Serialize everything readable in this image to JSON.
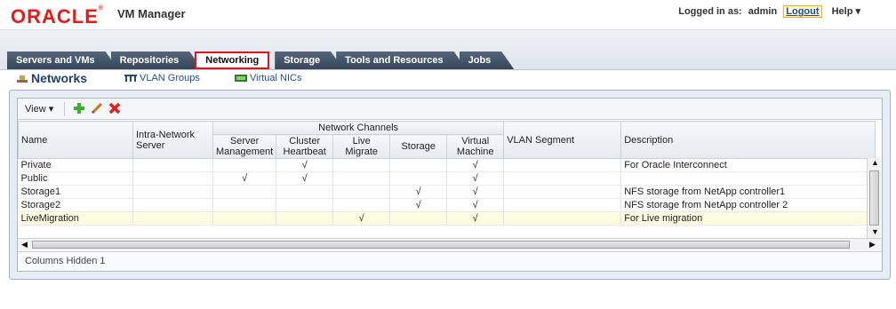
{
  "brand": {
    "logo": "ORACLE",
    "app_title": "VM Manager"
  },
  "header": {
    "logged_in_label": "Logged in as:",
    "user": "admin",
    "logout": "Logout",
    "help": "Help"
  },
  "tabs": [
    {
      "label": "Servers and VMs",
      "active": false
    },
    {
      "label": "Repositories",
      "active": false
    },
    {
      "label": "Networking",
      "active": true
    },
    {
      "label": "Storage",
      "active": false
    },
    {
      "label": "Tools and Resources",
      "active": false
    },
    {
      "label": "Jobs",
      "active": false
    }
  ],
  "subnav": {
    "networks": "Networks",
    "vlan_groups": "VLAN Groups",
    "virtual_nics": "Virtual NICs"
  },
  "toolbar": {
    "view_label": "View",
    "icons": [
      "add-icon",
      "edit-icon",
      "delete-icon"
    ]
  },
  "table": {
    "headers": {
      "name": "Name",
      "intra_network_server": "Intra-Network Server",
      "network_channels": "Network Channels",
      "server_management": "Server Management",
      "cluster_heartbeat": "Cluster Heartbeat",
      "live_migrate": "Live Migrate",
      "storage": "Storage",
      "virtual_machine": "Virtual Machine",
      "vlan_segment": "VLAN Segment",
      "description": "Description"
    },
    "check_glyph": "√",
    "rows": [
      {
        "name": "Private",
        "intra": "",
        "mgmt": "",
        "heartbeat": "√",
        "migrate": "",
        "storage": "",
        "vm": "√",
        "vlan": "",
        "description": "For Oracle Interconnect",
        "selected": false
      },
      {
        "name": "Public",
        "intra": "",
        "mgmt": "√",
        "heartbeat": "√",
        "migrate": "",
        "storage": "",
        "vm": "√",
        "vlan": "",
        "description": "",
        "selected": false
      },
      {
        "name": "Storage1",
        "intra": "",
        "mgmt": "",
        "heartbeat": "",
        "migrate": "",
        "storage": "√",
        "vm": "√",
        "vlan": "",
        "description": "NFS storage from NetApp controller1",
        "selected": false
      },
      {
        "name": "Storage2",
        "intra": "",
        "mgmt": "",
        "heartbeat": "",
        "migrate": "",
        "storage": "√",
        "vm": "√",
        "vlan": "",
        "description": "NFS storage from NetApp controller 2",
        "selected": false
      },
      {
        "name": "LiveMigration",
        "intra": "",
        "mgmt": "",
        "heartbeat": "",
        "migrate": "√",
        "storage": "",
        "vm": "√",
        "vlan": "",
        "description": "For Live migration",
        "selected": true
      }
    ]
  },
  "status": {
    "columns_hidden": "Columns Hidden 1"
  },
  "colors": {
    "brand_red": "#e41b17",
    "tab_dark": "#3b4a5e",
    "active_outline": "#e0141e",
    "selected_row": "#fffbe0"
  }
}
